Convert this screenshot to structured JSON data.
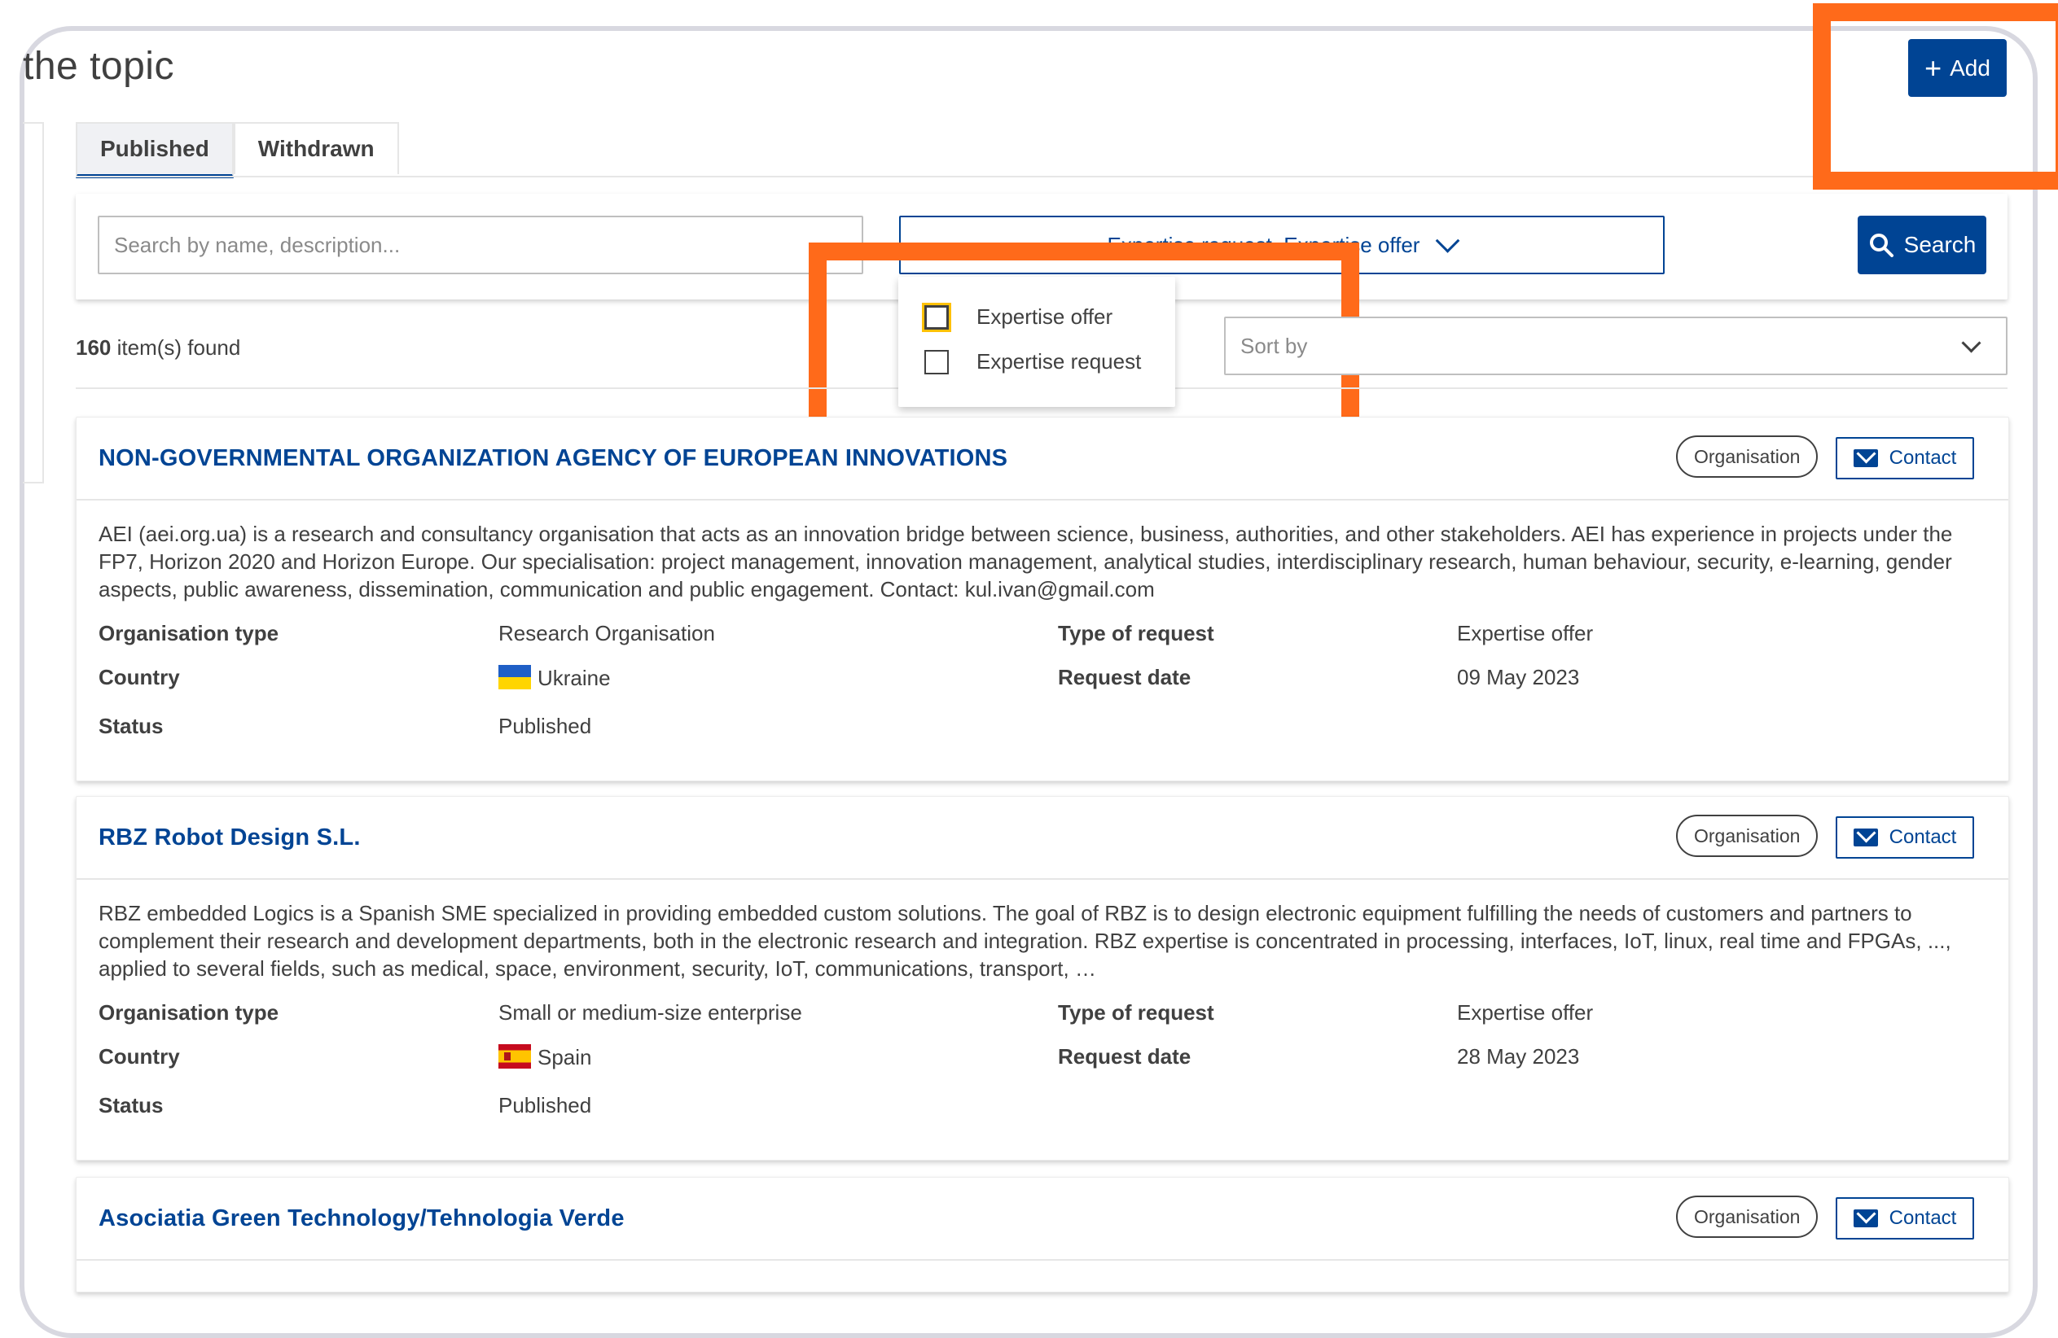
{
  "header": {
    "title": "the topic",
    "add_label": "Add"
  },
  "tabs": [
    {
      "label": "Published",
      "active": true
    },
    {
      "label": "Withdrawn",
      "active": false
    }
  ],
  "search": {
    "placeholder": "Search by name, description...",
    "type_select_value": "Expertise request, Expertise offer",
    "search_label": "Search"
  },
  "dropdown": {
    "options": [
      {
        "label": "Expertise offer",
        "checked": false
      },
      {
        "label": "Expertise request",
        "checked": false
      }
    ]
  },
  "results": {
    "count": "160",
    "count_suffix": " item(s) found",
    "sort_placeholder": "Sort by"
  },
  "labels": {
    "organisation_type": "Organisation type",
    "country": "Country",
    "status": "Status",
    "type_of_request": "Type of request",
    "request_date": "Request date",
    "badge": "Organisation",
    "contact": "Contact"
  },
  "cards": [
    {
      "title": "NON-GOVERNMENTAL ORGANIZATION AGENCY OF EUROPEAN INNOVATIONS",
      "description": "AEI (aei.org.ua) is a research and consultancy organisation that acts as an innovation bridge between science, business, authorities, and other stakeholders. AEI has experience in projects under the FP7, Horizon 2020 and Horizon Europe. Our specialisation: project management, innovation management, analytical studies, interdisciplinary research, human behaviour, security, e-learning, gender aspects, public awareness, dissemination, communication and public engagement. Contact: kul.ivan@gmail.com",
      "organisation_type": "Research Organisation",
      "country": "Ukraine",
      "status": "Published",
      "type_of_request": "Expertise offer",
      "request_date": "09 May 2023"
    },
    {
      "title": "RBZ Robot Design S.L.",
      "description": "RBZ embedded Logics is a Spanish SME specialized in providing embedded custom solutions. The goal of RBZ is to design electronic equipment fulfilling the needs of customers and partners to complement their research and development departments, both in the electronic research and integration. RBZ expertise is concentrated in processing, interfaces, IoT, linux, real time and FPGAs, ..., applied to several fields, such as medical, space, environment, security, IoT, communications, transport, …",
      "organisation_type": "Small or medium-size enterprise",
      "country": "Spain",
      "status": "Published",
      "type_of_request": "Expertise offer",
      "request_date": "28 May 2023"
    },
    {
      "title": "Asociatia Green Technology/Tehnologia Verde"
    }
  ],
  "colors": {
    "primary": "#004494",
    "highlight": "#ff6a1a",
    "focus": "#ffc107"
  }
}
